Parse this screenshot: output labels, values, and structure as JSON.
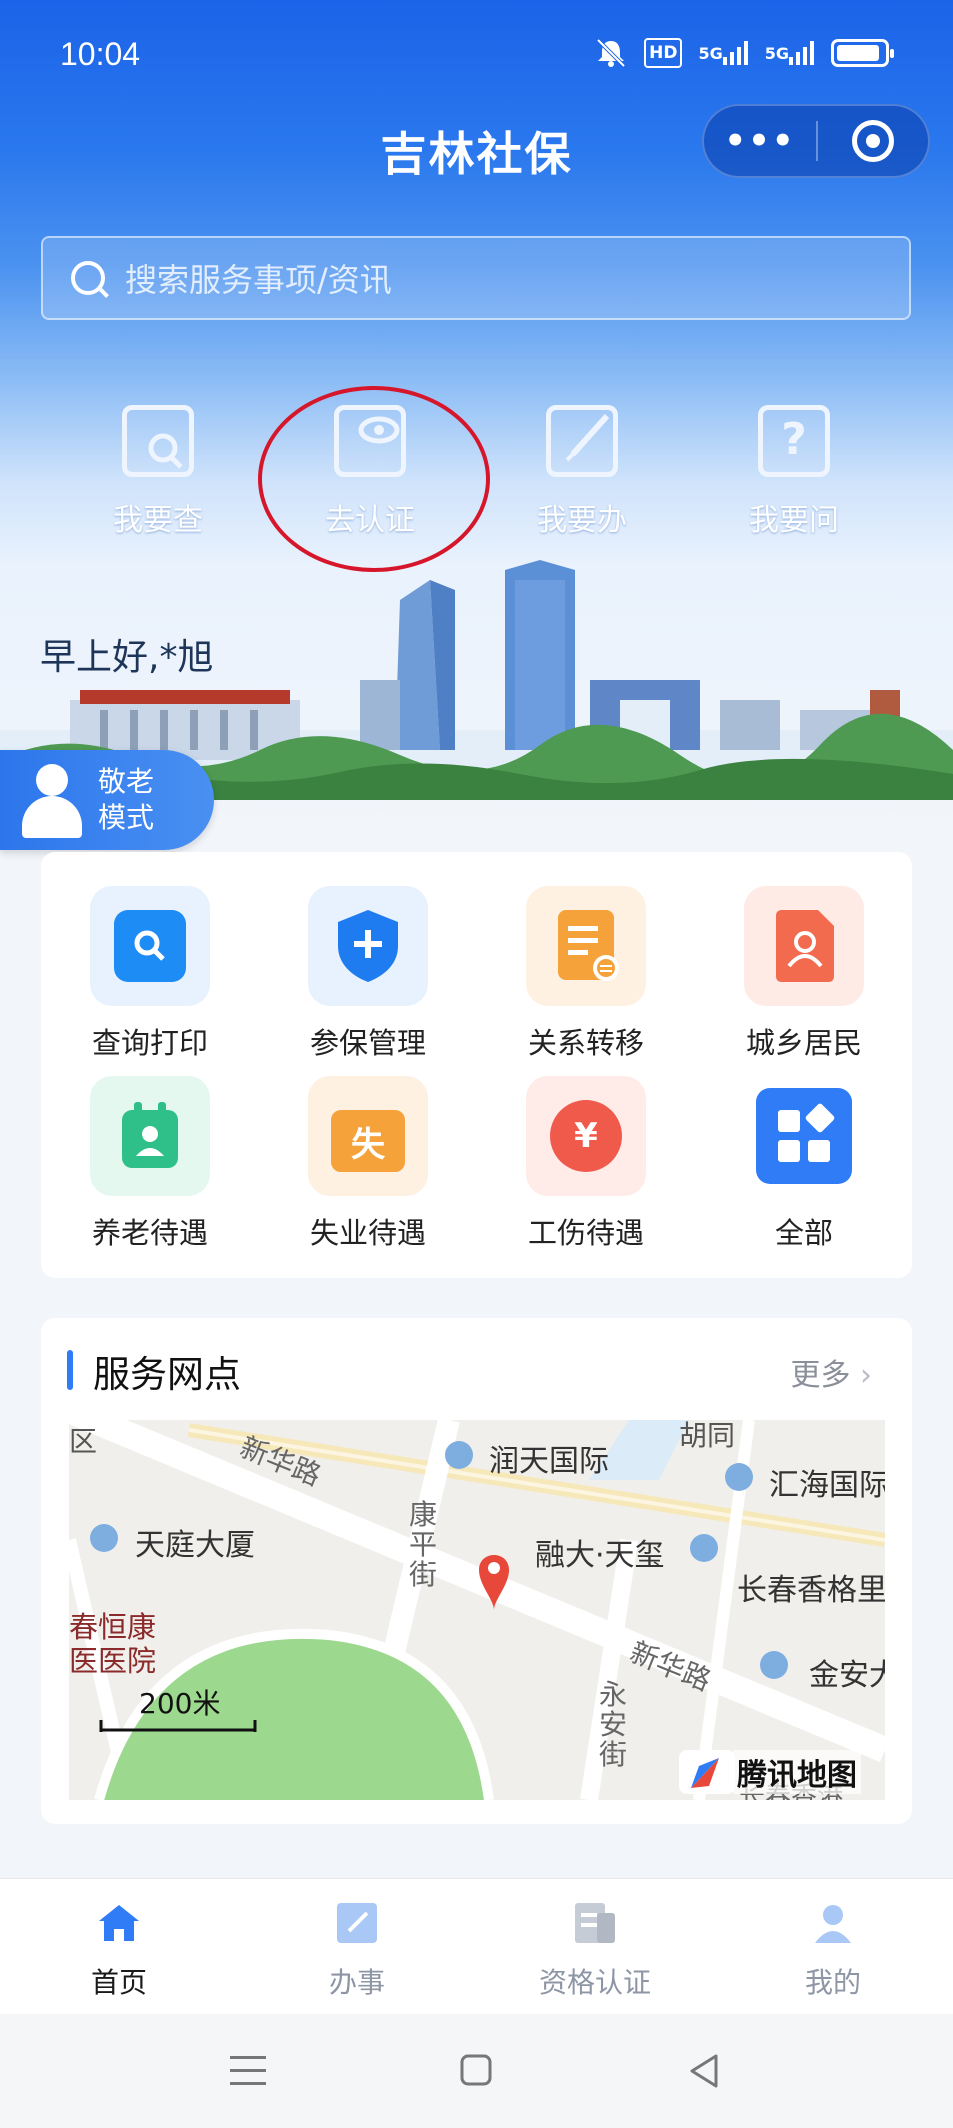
{
  "status_bar": {
    "time": "10:04",
    "hd": "HD",
    "net1": "5G",
    "net2": "5G"
  },
  "header": {
    "title": "吉林社保",
    "more_label": "•••"
  },
  "search": {
    "placeholder": "搜索服务事项/资讯"
  },
  "quick_actions": [
    {
      "label": "我要查",
      "icon": "document-search-icon"
    },
    {
      "label": "去认证",
      "icon": "eye-verify-icon"
    },
    {
      "label": "我要办",
      "icon": "edit-icon"
    },
    {
      "label": "我要问",
      "icon": "question-icon"
    }
  ],
  "greeting": "早上好,*旭",
  "elder_mode": {
    "line1": "敬老",
    "line2": "模式"
  },
  "services": [
    {
      "label": "查询打印",
      "icon": "search-icon",
      "color": "#1e8cf5",
      "bg": "#e8f2fe"
    },
    {
      "label": "参保管理",
      "icon": "shield-plus-icon",
      "color": "#1e7cf0",
      "bg": "#e8f1fe"
    },
    {
      "label": "关系转移",
      "icon": "transfer-doc-icon",
      "color": "#f5a23a",
      "bg": "#fff1e2"
    },
    {
      "label": "城乡居民",
      "icon": "resident-doc-icon",
      "color": "#f26b4f",
      "bg": "#ffebe6"
    },
    {
      "label": "养老待遇",
      "icon": "pension-icon",
      "color": "#2fc08a",
      "bg": "#e4f8f0"
    },
    {
      "label": "失业待遇",
      "icon": "briefcase-icon",
      "color": "#f5a23a",
      "bg": "#fff1e2",
      "glyph": "失"
    },
    {
      "label": "工伤待遇",
      "icon": "yuan-icon",
      "color": "#f05a4a",
      "bg": "#ffebe8",
      "glyph": "¥"
    },
    {
      "label": "全部",
      "icon": "grid-all-icon",
      "color": "#2f7cf6",
      "bg": "#ffffff"
    }
  ],
  "service_points": {
    "title": "服务网点",
    "more": "更多",
    "map": {
      "labels": {
        "district": "区",
        "xinhua1": "新华路",
        "runtian": "润天国际",
        "huihai": "汇海国际",
        "tianting": "天庭大厦",
        "kangping": "康平街",
        "rongda": "融大·天玺",
        "changchun_shangri": "长春香格里",
        "hengkang1": "春恒康",
        "hengkang2": "医医院",
        "xinhua2": "新华路",
        "jinan": "金安大",
        "yongan": "永安街",
        "scale": "200米",
        "provider": "腾讯地图",
        "tong": "胡同",
        "bottom_cut": "长春香港"
      }
    }
  },
  "tabbar": [
    {
      "label": "首页",
      "icon": "home-icon",
      "active": true
    },
    {
      "label": "办事",
      "icon": "edit-icon",
      "active": false
    },
    {
      "label": "资格认证",
      "icon": "certificate-icon",
      "active": false
    },
    {
      "label": "我的",
      "icon": "user-icon",
      "active": false
    }
  ]
}
